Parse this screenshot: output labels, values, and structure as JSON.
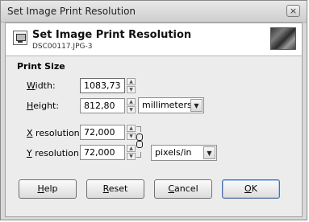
{
  "window": {
    "title": "Set Image Print Resolution",
    "close_symbol": "×"
  },
  "header": {
    "title": "Set Image Print Resolution",
    "subtitle": "DSC00117.JPG-3"
  },
  "print_size": {
    "section_label": "Print Size",
    "width": {
      "label_first": "W",
      "label_rest": "idth:",
      "value": "1083,73"
    },
    "height": {
      "label_first": "H",
      "label_rest": "eight:",
      "value": "812,80"
    },
    "size_unit": "millimeters",
    "x_resolution": {
      "label_first": "X",
      "label_rest": " resolution:",
      "value": "72,000"
    },
    "y_resolution": {
      "label_first": "Y",
      "label_rest": " resolution:",
      "value": "72,000"
    },
    "resolution_unit": "pixels/in"
  },
  "buttons": {
    "help": {
      "first": "H",
      "rest": "elp"
    },
    "reset": {
      "first": "R",
      "rest": "eset"
    },
    "cancel": {
      "first": "C",
      "rest": "ancel"
    },
    "ok": {
      "first": "O",
      "rest": "K"
    }
  }
}
